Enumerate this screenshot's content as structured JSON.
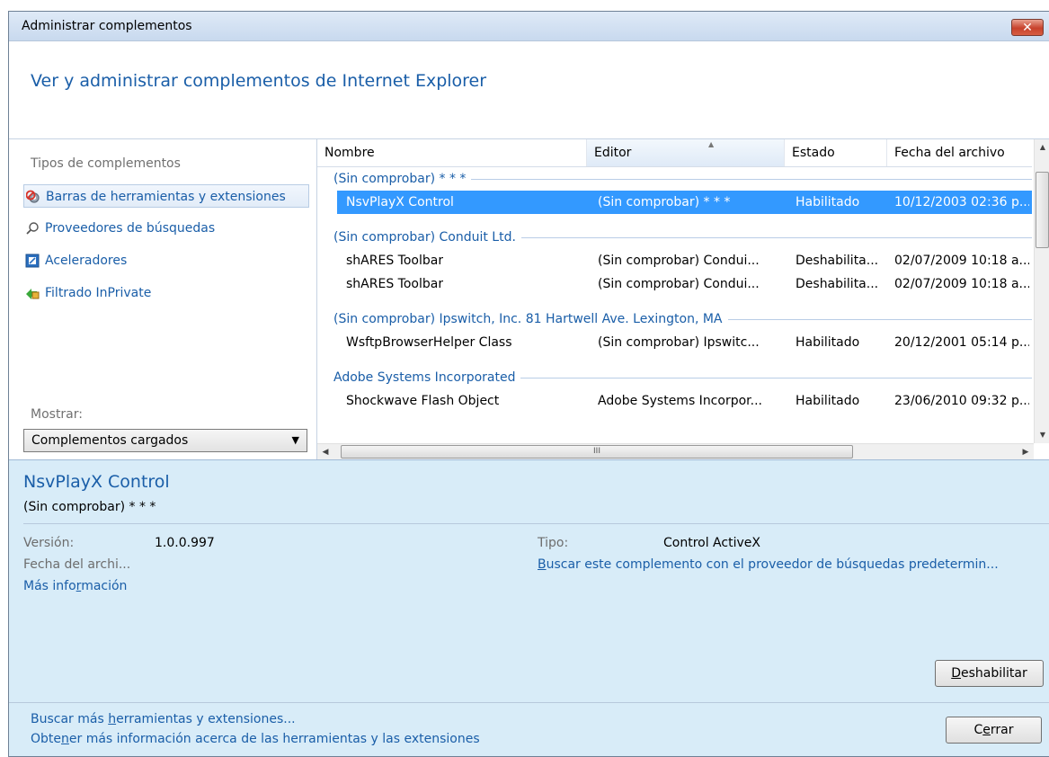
{
  "window": {
    "title": "Administrar complementos",
    "close_glyph": "✕"
  },
  "header": {
    "title": "Ver y administrar complementos de Internet Explorer"
  },
  "sidebar": {
    "caption": "Tipos de complementos",
    "items": [
      {
        "label": "Barras de herramientas y extensiones",
        "icon": "gear-icon"
      },
      {
        "label": "Proveedores de búsquedas",
        "icon": "search-icon"
      },
      {
        "label": "Aceleradores",
        "icon": "accelerator-icon"
      },
      {
        "label": "Filtrado InPrivate",
        "icon": "inprivate-icon"
      }
    ],
    "show_label": "Mostrar:",
    "show_value": "Complementos cargados"
  },
  "grid": {
    "columns": [
      "Nombre",
      "Editor",
      "Estado",
      "Fecha del archivo"
    ],
    "groups": [
      "(Sin comprobar) * * *",
      "(Sin comprobar) Conduit Ltd.",
      "(Sin comprobar) Ipswitch, Inc. 81 Hartwell Ave. Lexington, MA",
      "Adobe Systems Incorporated"
    ],
    "rows": [
      {
        "name": "NsvPlayX Control",
        "editor": "(Sin comprobar) * * *",
        "status": "Habilitado",
        "date": "10/12/2003 02:36 p..."
      },
      {
        "name": "shARES Toolbar",
        "editor": "(Sin comprobar) Condui...",
        "status": "Deshabilita...",
        "date": "02/07/2009 10:18 a..."
      },
      {
        "name": "shARES Toolbar",
        "editor": "(Sin comprobar) Condui...",
        "status": "Deshabilita...",
        "date": "02/07/2009 10:18 a..."
      },
      {
        "name": "WsftpBrowserHelper Class",
        "editor": "(Sin comprobar) Ipswitc...",
        "status": "Habilitado",
        "date": "20/12/2001 05:14 p..."
      },
      {
        "name": "Shockwave Flash Object",
        "editor": "Adobe Systems Incorpor...",
        "status": "Habilitado",
        "date": "23/06/2010 09:32 p..."
      }
    ],
    "hscroll_grip": "III"
  },
  "details": {
    "name": "NsvPlayX Control",
    "publisher": "(Sin comprobar) * * *",
    "version_label": "Versión:",
    "version_value": "1.0.0.997",
    "date_label": "Fecha del archi...",
    "more_info": "Más información",
    "type_label": "Tipo:",
    "type_value": "Control ActiveX",
    "search_link": "Buscar este complemento con el proveedor de búsquedas predetermin...",
    "disable_button": "Deshabilitar"
  },
  "footer": {
    "link1": "Buscar más herramientas y extensiones...",
    "link2": "Obtener más información acerca de las herramientas y las extensiones",
    "close_button": "Cerrar"
  },
  "colors": {
    "accent": "#1a5ea8",
    "selection": "#3399ff",
    "details_bg": "#d8ecf8"
  }
}
